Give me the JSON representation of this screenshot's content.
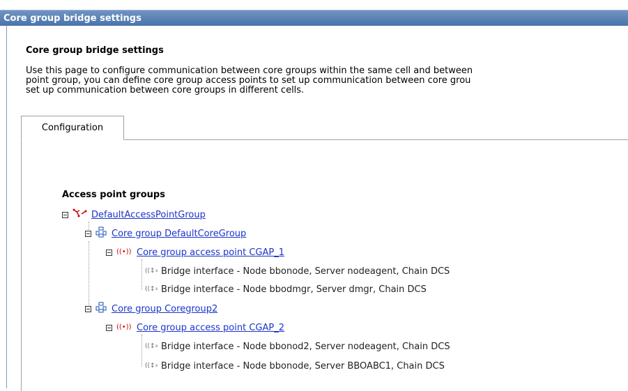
{
  "title_bar": "Core group bridge settings",
  "page": {
    "heading": "Core group bridge settings",
    "description_lines": [
      "Use this page to configure communication between core groups within the same cell and between",
      "point group, you can define core group access points to set up communication between core grou",
      "set up communication between core groups in different cells."
    ]
  },
  "tabs": [
    {
      "label": "Configuration"
    }
  ],
  "tree": {
    "section_title": "Access point groups",
    "apg": {
      "label": "DefaultAccessPointGroup"
    },
    "cg1": {
      "label": "Core group DefaultCoreGroup"
    },
    "cgap1": {
      "label": "Core group access point CGAP_1"
    },
    "bi1": {
      "label": "Bridge interface - Node bbonode, Server nodeagent, Chain DCS"
    },
    "bi2": {
      "label": "Bridge interface - Node bbodmgr, Server dmgr, Chain DCS"
    },
    "cg2": {
      "label": "Core group Coregroup2"
    },
    "cgap2": {
      "label": "Core group access point CGAP_2"
    },
    "bi3": {
      "label": "Bridge interface - Node bbonod2, Server nodeagent, Chain DCS"
    },
    "bi4": {
      "label": "Bridge interface - Node bbonode, Server BBOABC1, Chain DCS"
    }
  },
  "icons": {
    "apg": "access-point-group-icon",
    "core_group": "core-group-icon",
    "access_point": "access-point-icon",
    "bridge_interface": "bridge-interface-icon"
  }
}
